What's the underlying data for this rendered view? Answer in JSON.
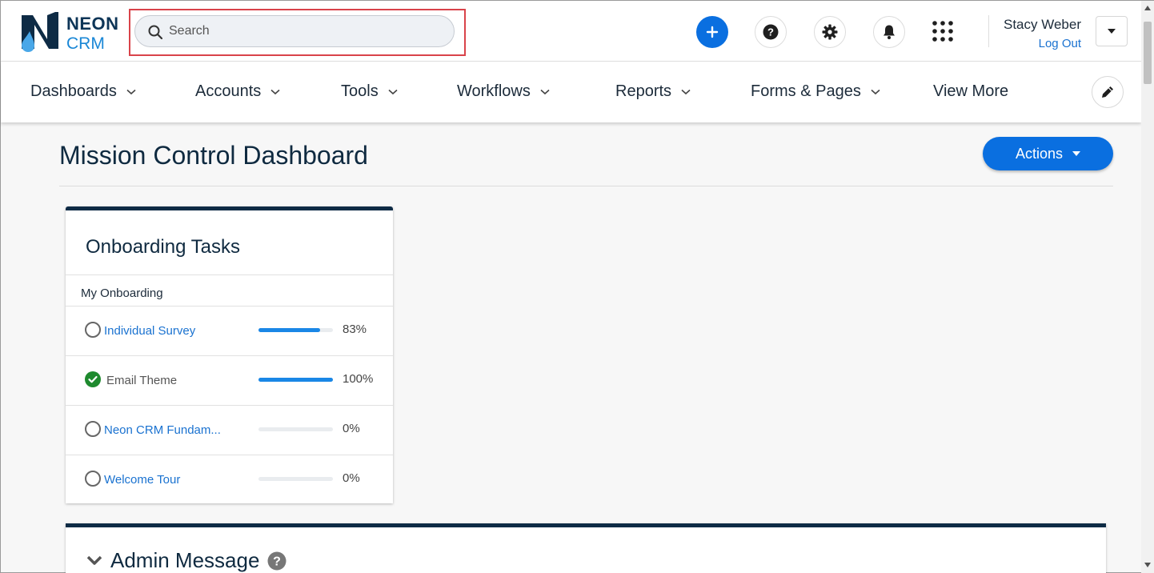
{
  "header": {
    "logo": {
      "word1": "NEON",
      "word2": "CRM"
    },
    "search": {
      "placeholder": "Search"
    },
    "icons": [
      "plus-icon",
      "help-icon",
      "gear-icon",
      "bell-icon",
      "apps-grid-icon"
    ],
    "user": {
      "name": "Stacy Weber",
      "logout_label": "Log Out"
    }
  },
  "nav": {
    "items": [
      {
        "label": "Dashboards",
        "has_dropdown": true
      },
      {
        "label": "Accounts",
        "has_dropdown": true
      },
      {
        "label": "Tools",
        "has_dropdown": true
      },
      {
        "label": "Workflows",
        "has_dropdown": true
      },
      {
        "label": "Reports",
        "has_dropdown": true
      },
      {
        "label": "Forms & Pages",
        "has_dropdown": true
      },
      {
        "label": "View More",
        "has_dropdown": false
      }
    ]
  },
  "page": {
    "title": "Mission Control Dashboard",
    "actions_label": "Actions"
  },
  "onboarding": {
    "title": "Onboarding Tasks",
    "subtitle": "My Onboarding",
    "tasks": [
      {
        "label": "Individual Survey",
        "percent_label": "83%",
        "progress": 0.83,
        "complete": false
      },
      {
        "label": "Email Theme",
        "percent_label": "100%",
        "progress": 1.0,
        "complete": true
      },
      {
        "label": "Neon CRM Fundam...",
        "percent_label": "0%",
        "progress": 0.0,
        "complete": false
      },
      {
        "label": "Welcome Tour",
        "percent_label": "0%",
        "progress": 0.0,
        "complete": false
      }
    ]
  },
  "admin_message": {
    "title": "Admin Message"
  },
  "colors": {
    "primary_blue": "#0a6fe0",
    "navy": "#0e2b45",
    "link_blue": "#1a72d0",
    "success_green": "#1e8a2e",
    "highlight_red": "#d9434a"
  }
}
